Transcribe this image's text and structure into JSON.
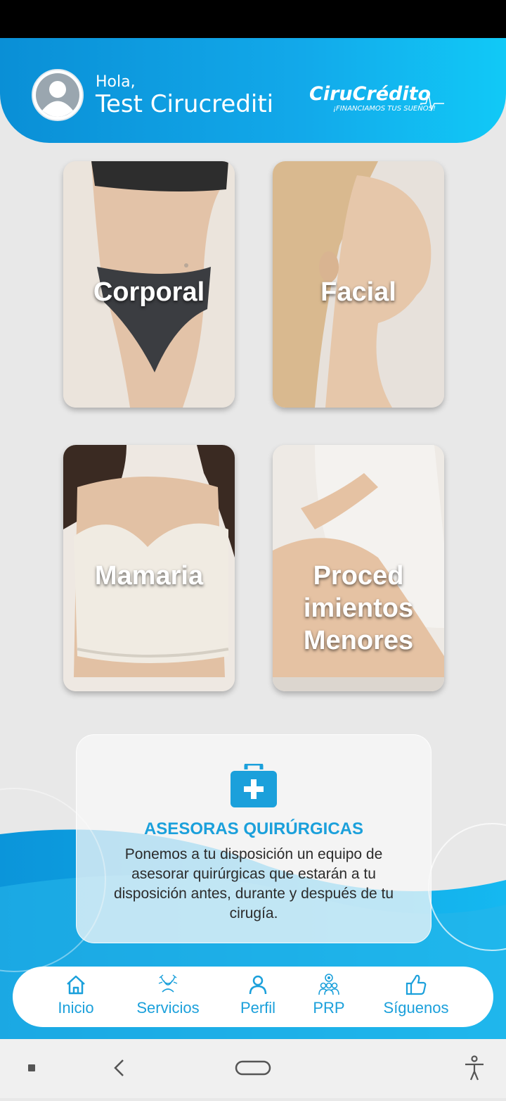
{
  "header": {
    "greeting": "Hola,",
    "user_name": "Test Cirucrediti",
    "brand_name": "CiruCrédito",
    "brand_tagline": "¡FINANCIAMOS TUS SUEÑOS!"
  },
  "categories": [
    {
      "label": "Corporal"
    },
    {
      "label": "Facial"
    },
    {
      "label": "Mamaria"
    },
    {
      "label_lines": [
        "Proced",
        "imientos",
        "Menores"
      ]
    }
  ],
  "info_card": {
    "icon": "first-aid-kit-icon",
    "title": "ASESORAS QUIRÚRGICAS",
    "description": "Ponemos a tu disposición un equipo de asesorar quirúrgicas que estarán a tu disposición antes, durante y después de tu cirugía."
  },
  "bottom_nav": [
    {
      "label": "Inicio",
      "icon": "home-icon"
    },
    {
      "label": "Servicios",
      "icon": "services-icon"
    },
    {
      "label": "Perfil",
      "icon": "user-icon"
    },
    {
      "label": "PRP",
      "icon": "group-icon"
    },
    {
      "label": "Síguenos",
      "icon": "thumbs-up-icon"
    }
  ],
  "colors": {
    "accent": "#1ba0db",
    "header_start": "#0a8fd6",
    "header_end": "#11c9f7"
  }
}
